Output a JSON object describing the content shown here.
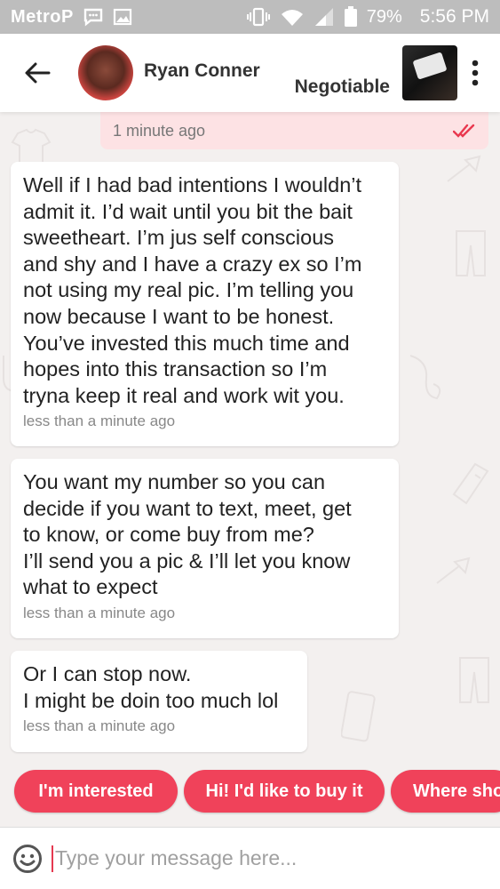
{
  "status_bar": {
    "carrier": "MetroP",
    "battery": "79%",
    "time": "5:56 PM"
  },
  "header": {
    "contact_name": "Ryan Conner",
    "price_label": "Negotiable"
  },
  "messages": [
    {
      "direction": "outgoing",
      "time": "1 minute ago"
    },
    {
      "direction": "incoming",
      "text": "Well if I had bad intentions I wouldn’t\nadmit it. I’d wait until you bit the bait\nsweetheart. I’m jus self conscious\nand shy and I have a crazy ex so I’m\nnot using my real pic.   I’m telling you\nnow because I want to be honest.\nYou’ve invested this much time and\nhopes into this transaction so I’m\ntryna keep it real and work wit you.",
      "time": "less than a minute ago"
    },
    {
      "direction": "incoming",
      "text": "You want my number so you can\ndecide if you want to text, meet, get\nto know, or come buy from me?\nI’ll send you a pic & I’ll let you know\nwhat to expect",
      "time": "less than a minute ago"
    },
    {
      "direction": "incoming",
      "text": "Or I can stop now.\nI might be doin too much lol",
      "time": "less than a minute ago"
    }
  ],
  "quick_replies": [
    "I'm interested",
    "Hi! I'd like to buy it",
    "Where sho"
  ],
  "input": {
    "placeholder": "Type your message here..."
  },
  "colors": {
    "accent": "#f0425a",
    "sent_bubble": "#fde2e4",
    "status_bar": "#bdbdbd",
    "chat_background": "#f3f0ef"
  }
}
